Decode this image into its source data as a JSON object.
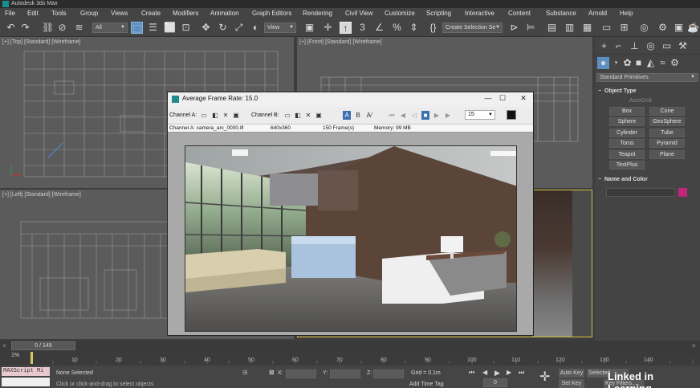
{
  "app": {
    "title": "Autodesk 3ds Max"
  },
  "menu": [
    "File",
    "Edit",
    "Tools",
    "Group",
    "Views",
    "Create",
    "Modifiers",
    "Animation",
    "Graph Editors",
    "Rendering",
    "Civil View",
    "Customize",
    "Scripting",
    "Interactive",
    "Content",
    "Substance",
    "Arnold",
    "Help"
  ],
  "toolbar": {
    "selection_filter": "All",
    "ref_coord": "View",
    "named_selection": "Create Selection Se"
  },
  "viewports": {
    "top": "[+] [Top] [Standard] [Wireframe]",
    "front": "[+] [Front] [Standard] [Wireframe]",
    "left": "[+] [Left] [Standard] [Wireframe]"
  },
  "command_panel": {
    "category": "Standard Primitives",
    "object_type_title": "Object Type",
    "autogrid": "AutoGrid",
    "primitives": [
      "Box",
      "Cone",
      "Sphere",
      "GeoSphere",
      "Cylinder",
      "Tube",
      "Torus",
      "Pyramid",
      "Teapot",
      "Plane",
      "TextPlus"
    ],
    "name_color_title": "Name and Color",
    "swatch_color": "#c0267a"
  },
  "vfb": {
    "title": "Average Frame Rate: 15.0",
    "channel_a_label": "Channel A:",
    "channel_b_label": "Channel B:",
    "frame_value": "15",
    "status_file": "Channel A: camera_arc_0000.ifl",
    "status_res": "640x360",
    "status_frames": "150 Frame(s)",
    "status_memory": "Memory: 99 MB"
  },
  "time": {
    "slider_label": "0 / 149",
    "ticks": [
      "0",
      "10",
      "20",
      "30",
      "40",
      "50",
      "60",
      "70",
      "80",
      "90",
      "100",
      "110",
      "120",
      "130",
      "140"
    ]
  },
  "status": {
    "maxscript": "MAXScript Mi",
    "selected": "None Selected",
    "prompt": "Click or click-and-drag to select objects",
    "x_label": "X:",
    "y_label": "Y:",
    "z_label": "Z:",
    "grid": "Grid = 0.1m",
    "add_time_tag": "Add Time Tag",
    "auto_key": "Auto Key",
    "set_key": "Set Key",
    "selected_dropdown": "Selected",
    "key_filters": "Key Filters...",
    "frame_field": "0"
  },
  "watermark": "Linked in Learning"
}
